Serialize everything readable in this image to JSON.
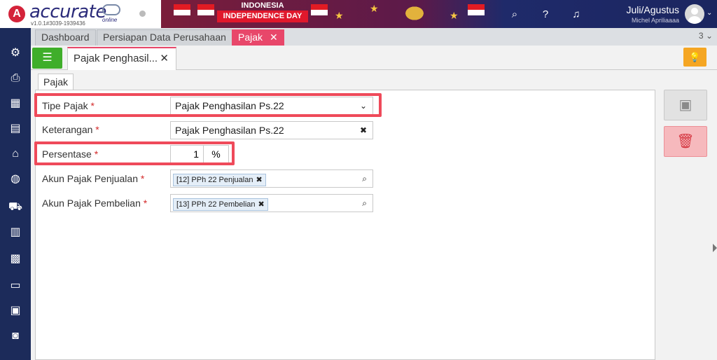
{
  "app": {
    "logo_letter": "A",
    "logo": "accurate",
    "logo_sub": "online",
    "version": "v1.0.1#3039-1939436"
  },
  "banner": {
    "title": "INDONESIA",
    "subtitle": "INDEPENDENCE DAY"
  },
  "header": {
    "icons": [
      "search-icon",
      "help-icon",
      "bell-icon"
    ],
    "period": "Juli/Agustus",
    "user": "Michel Apriliaaaa"
  },
  "tabs": [
    {
      "label": "Dashboard"
    },
    {
      "label": "Persiapan Data Perusahaan"
    },
    {
      "label": "Pajak",
      "active": true
    }
  ],
  "tabs_count": "3",
  "doc_tab": {
    "label": "Pajak Penghasil..."
  },
  "inner_tab": "Pajak",
  "form": {
    "tipe_pajak": {
      "label": "Tipe Pajak",
      "value": "Pajak Penghasilan Ps.22"
    },
    "keterangan": {
      "label": "Keterangan",
      "value": "Pajak Penghasilan Ps.22"
    },
    "persentase": {
      "label": "Persentase",
      "value": "1",
      "unit": "%"
    },
    "akun_penjualan": {
      "label": "Akun Pajak Penjualan",
      "chip": "[12] PPh 22 Penjualan"
    },
    "akun_pembelian": {
      "label": "Akun Pajak Pembelian",
      "chip": "[13] PPh 22 Pembelian"
    },
    "required_mark": "*"
  },
  "colors": {
    "accent": "#e8476a",
    "sidebar": "#1c2b5a",
    "highlight": "#ef4a5a",
    "list_button": "#3fae2a"
  }
}
